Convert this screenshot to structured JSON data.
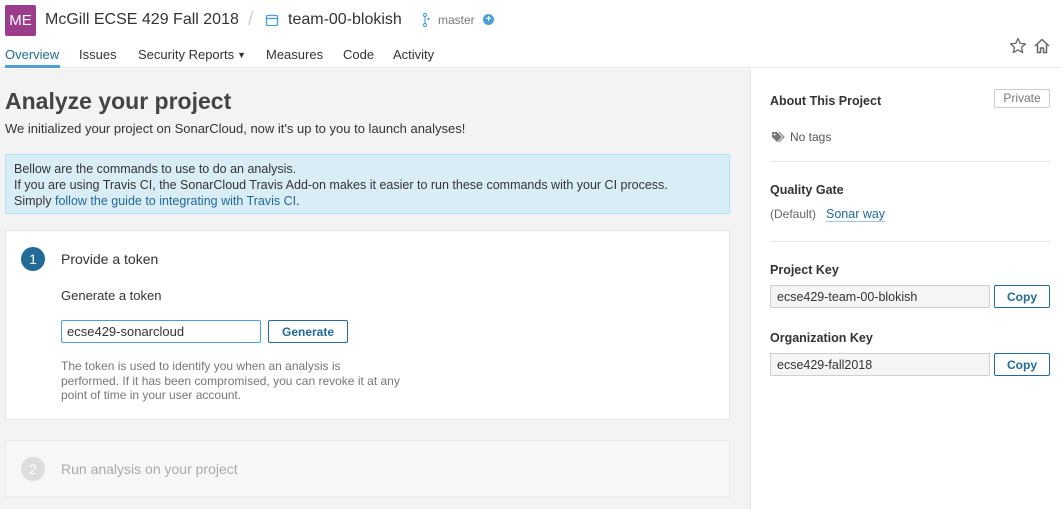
{
  "header": {
    "org_avatar": "ME",
    "org_name": "McGill ECSE 429 Fall 2018",
    "separator": "/",
    "project_name": "team-00-blokish",
    "branch": "master",
    "add_icon": "+"
  },
  "nav": {
    "tabs": [
      {
        "label": "Overview",
        "active": true
      },
      {
        "label": "Issues"
      },
      {
        "label": "Security Reports"
      },
      {
        "label": "Measures"
      },
      {
        "label": "Code"
      },
      {
        "label": "Activity"
      }
    ],
    "dropdown_caret": "▼"
  },
  "icons": {
    "star": "star-icon",
    "home": "home-icon",
    "project": "project-icon",
    "branch": "branch-icon",
    "tag": "tag-icon"
  },
  "main": {
    "title": "Analyze your project",
    "subtitle": "We initialized your project on SonarCloud, now it's up to you to launch analyses!",
    "info": {
      "line1": "Bellow are the commands to use to do an analysis.",
      "line2": "If you are using Travis CI, the SonarCloud Travis Add-on makes it easier to run these commands with your CI process.",
      "line3_prefix": "Simply ",
      "line3_link": "follow the guide to integrating with Travis CI",
      "line3_suffix": "."
    },
    "step1": {
      "number": "1",
      "title": "Provide a token",
      "label": "Generate a token",
      "input_value": "ecse429-sonarcloud",
      "button": "Generate",
      "help": "The token is used to identify you when an analysis is performed. If it has been compromised, you can revoke it at any point of time in your user account."
    },
    "step2": {
      "number": "2",
      "title": "Run analysis on your project"
    }
  },
  "sidebar": {
    "about_title": "About This Project",
    "private_badge": "Private",
    "no_tags": "No tags",
    "quality_gate_title": "Quality Gate",
    "quality_gate_default": "(Default)",
    "quality_gate_name": "Sonar way",
    "project_key_title": "Project Key",
    "project_key": "ecse429-team-00-blokish",
    "org_key_title": "Organization Key",
    "org_key": "ecse429-fall2018",
    "copy_label": "Copy"
  },
  "colors": {
    "accent": "#236a97",
    "accent_light": "#4b9fd5",
    "avatar": "#9c3c8c",
    "info_bg": "#d9edf7"
  }
}
